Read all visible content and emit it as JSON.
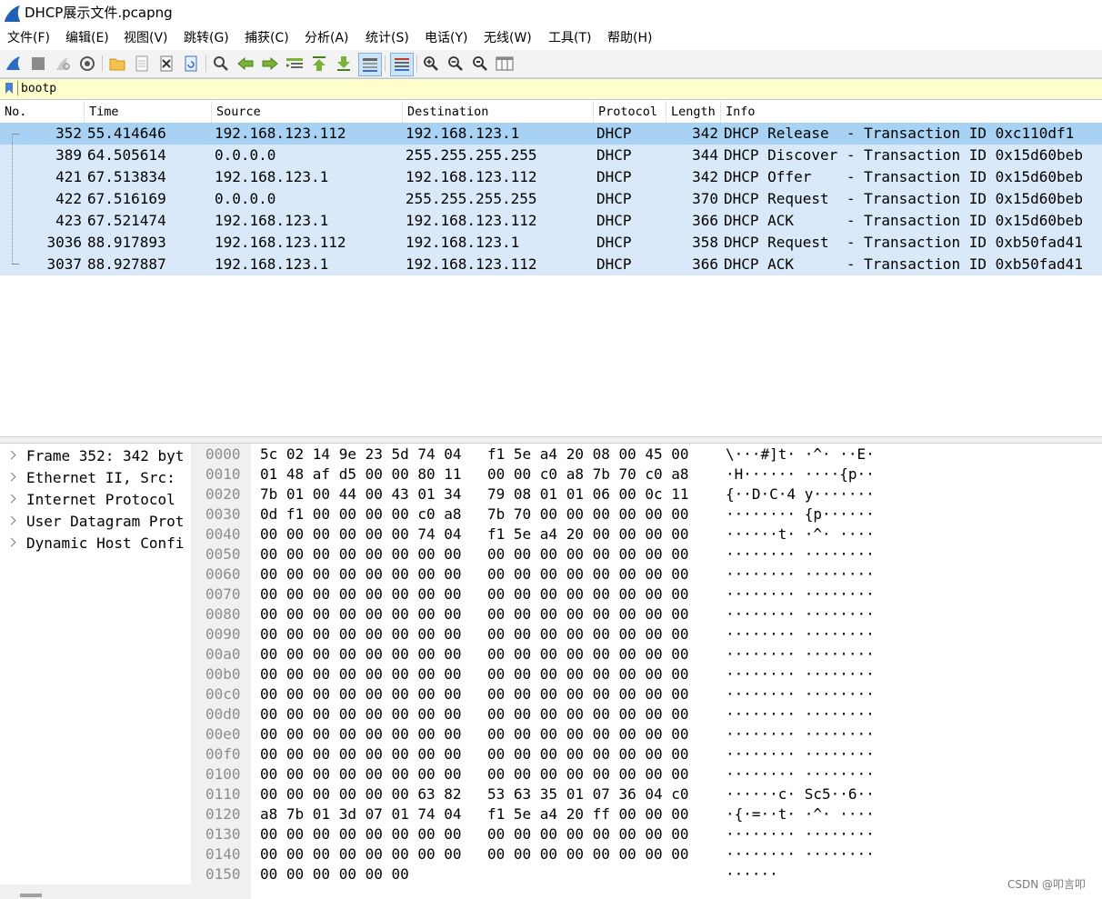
{
  "window": {
    "title": "DHCP展示文件.pcapng"
  },
  "menu": [
    "文件(F)",
    "编辑(E)",
    "视图(V)",
    "跳转(G)",
    "捕获(C)",
    "分析(A)",
    "统计(S)",
    "电话(Y)",
    "无线(W)",
    "工具(T)",
    "帮助(H)"
  ],
  "toolbar": {
    "buttons": [
      "shark-fin-icon",
      "stop-icon",
      "restart-icon",
      "capture-options-icon",
      "open-file-icon",
      "file-icon",
      "close-file-icon",
      "reload-icon",
      "find-icon",
      "go-back-icon",
      "go-forward-icon",
      "go-to-packet-icon",
      "first-packet-icon",
      "last-packet-icon",
      "autoscroll-icon",
      "colorize-icon",
      "zoom-in-icon",
      "zoom-out-icon",
      "normal-size-icon",
      "resize-columns-icon"
    ]
  },
  "filter": {
    "value": "bootp",
    "background": "#ffffcc"
  },
  "columns": [
    "No.",
    "Time",
    "Source",
    "Destination",
    "Protocol",
    "Length",
    "Info"
  ],
  "packets": [
    {
      "no": "352",
      "time": "55.414646",
      "source": "192.168.123.112",
      "destination": "192.168.123.1",
      "protocol": "DHCP",
      "length": "342",
      "info": "DHCP Release  - Transaction ID 0xc110df1",
      "selected": true
    },
    {
      "no": "389",
      "time": "64.505614",
      "source": "0.0.0.0",
      "destination": "255.255.255.255",
      "protocol": "DHCP",
      "length": "344",
      "info": "DHCP Discover - Transaction ID 0x15d60beb"
    },
    {
      "no": "421",
      "time": "67.513834",
      "source": "192.168.123.1",
      "destination": "192.168.123.112",
      "protocol": "DHCP",
      "length": "342",
      "info": "DHCP Offer    - Transaction ID 0x15d60beb"
    },
    {
      "no": "422",
      "time": "67.516169",
      "source": "0.0.0.0",
      "destination": "255.255.255.255",
      "protocol": "DHCP",
      "length": "370",
      "info": "DHCP Request  - Transaction ID 0x15d60beb"
    },
    {
      "no": "423",
      "time": "67.521474",
      "source": "192.168.123.1",
      "destination": "192.168.123.112",
      "protocol": "DHCP",
      "length": "366",
      "info": "DHCP ACK      - Transaction ID 0x15d60beb"
    },
    {
      "no": "3036",
      "time": "88.917893",
      "source": "192.168.123.112",
      "destination": "192.168.123.1",
      "protocol": "DHCP",
      "length": "358",
      "info": "DHCP Request  - Transaction ID 0xb50fad41"
    },
    {
      "no": "3037",
      "time": "88.927887",
      "source": "192.168.123.1",
      "destination": "192.168.123.112",
      "protocol": "DHCP",
      "length": "366",
      "info": "DHCP ACK      - Transaction ID 0xb50fad41"
    }
  ],
  "details": [
    "Frame 352: 342 byt",
    "Ethernet II, Src:",
    "Internet Protocol",
    "User Datagram Prot",
    "Dynamic Host Confi"
  ],
  "hex": [
    {
      "offset": "0000",
      "b1": "5c 02 14 9e 23 5d 74 04",
      "b2": "f1 5e a4 20 08 00 45 00",
      "ascii": "\\···#]t· ·^· ··E·"
    },
    {
      "offset": "0010",
      "b1": "01 48 af d5 00 00 80 11",
      "b2": "00 00 c0 a8 7b 70 c0 a8",
      "ascii": "·H······ ····{p··"
    },
    {
      "offset": "0020",
      "b1": "7b 01 00 44 00 43 01 34",
      "b2": "79 08 01 01 06 00 0c 11",
      "ascii": "{··D·C·4 y·······"
    },
    {
      "offset": "0030",
      "b1": "0d f1 00 00 00 00 c0 a8",
      "b2": "7b 70 00 00 00 00 00 00",
      "ascii": "········ {p······"
    },
    {
      "offset": "0040",
      "b1": "00 00 00 00 00 00 74 04",
      "b2": "f1 5e a4 20 00 00 00 00",
      "ascii": "······t· ·^· ····"
    },
    {
      "offset": "0050",
      "b1": "00 00 00 00 00 00 00 00",
      "b2": "00 00 00 00 00 00 00 00",
      "ascii": "········ ········"
    },
    {
      "offset": "0060",
      "b1": "00 00 00 00 00 00 00 00",
      "b2": "00 00 00 00 00 00 00 00",
      "ascii": "········ ········"
    },
    {
      "offset": "0070",
      "b1": "00 00 00 00 00 00 00 00",
      "b2": "00 00 00 00 00 00 00 00",
      "ascii": "········ ········"
    },
    {
      "offset": "0080",
      "b1": "00 00 00 00 00 00 00 00",
      "b2": "00 00 00 00 00 00 00 00",
      "ascii": "········ ········"
    },
    {
      "offset": "0090",
      "b1": "00 00 00 00 00 00 00 00",
      "b2": "00 00 00 00 00 00 00 00",
      "ascii": "········ ········"
    },
    {
      "offset": "00a0",
      "b1": "00 00 00 00 00 00 00 00",
      "b2": "00 00 00 00 00 00 00 00",
      "ascii": "········ ········"
    },
    {
      "offset": "00b0",
      "b1": "00 00 00 00 00 00 00 00",
      "b2": "00 00 00 00 00 00 00 00",
      "ascii": "········ ········"
    },
    {
      "offset": "00c0",
      "b1": "00 00 00 00 00 00 00 00",
      "b2": "00 00 00 00 00 00 00 00",
      "ascii": "········ ········"
    },
    {
      "offset": "00d0",
      "b1": "00 00 00 00 00 00 00 00",
      "b2": "00 00 00 00 00 00 00 00",
      "ascii": "········ ········"
    },
    {
      "offset": "00e0",
      "b1": "00 00 00 00 00 00 00 00",
      "b2": "00 00 00 00 00 00 00 00",
      "ascii": "········ ········"
    },
    {
      "offset": "00f0",
      "b1": "00 00 00 00 00 00 00 00",
      "b2": "00 00 00 00 00 00 00 00",
      "ascii": "········ ········"
    },
    {
      "offset": "0100",
      "b1": "00 00 00 00 00 00 00 00",
      "b2": "00 00 00 00 00 00 00 00",
      "ascii": "········ ········"
    },
    {
      "offset": "0110",
      "b1": "00 00 00 00 00 00 63 82",
      "b2": "53 63 35 01 07 36 04 c0",
      "ascii": "······c· Sc5··6··"
    },
    {
      "offset": "0120",
      "b1": "a8 7b 01 3d 07 01 74 04",
      "b2": "f1 5e a4 20 ff 00 00 00",
      "ascii": "·{·=··t· ·^· ····"
    },
    {
      "offset": "0130",
      "b1": "00 00 00 00 00 00 00 00",
      "b2": "00 00 00 00 00 00 00 00",
      "ascii": "········ ········"
    },
    {
      "offset": "0140",
      "b1": "00 00 00 00 00 00 00 00",
      "b2": "00 00 00 00 00 00 00 00",
      "ascii": "········ ········"
    },
    {
      "offset": "0150",
      "b1": "00 00 00 00 00 00",
      "b2": "",
      "ascii": "······"
    }
  ],
  "watermark": "CSDN @叩言叩",
  "colors": {
    "row": "#dae9f9",
    "row_selected": "#a8d2f4",
    "filter_bg": "#ffffcc"
  }
}
